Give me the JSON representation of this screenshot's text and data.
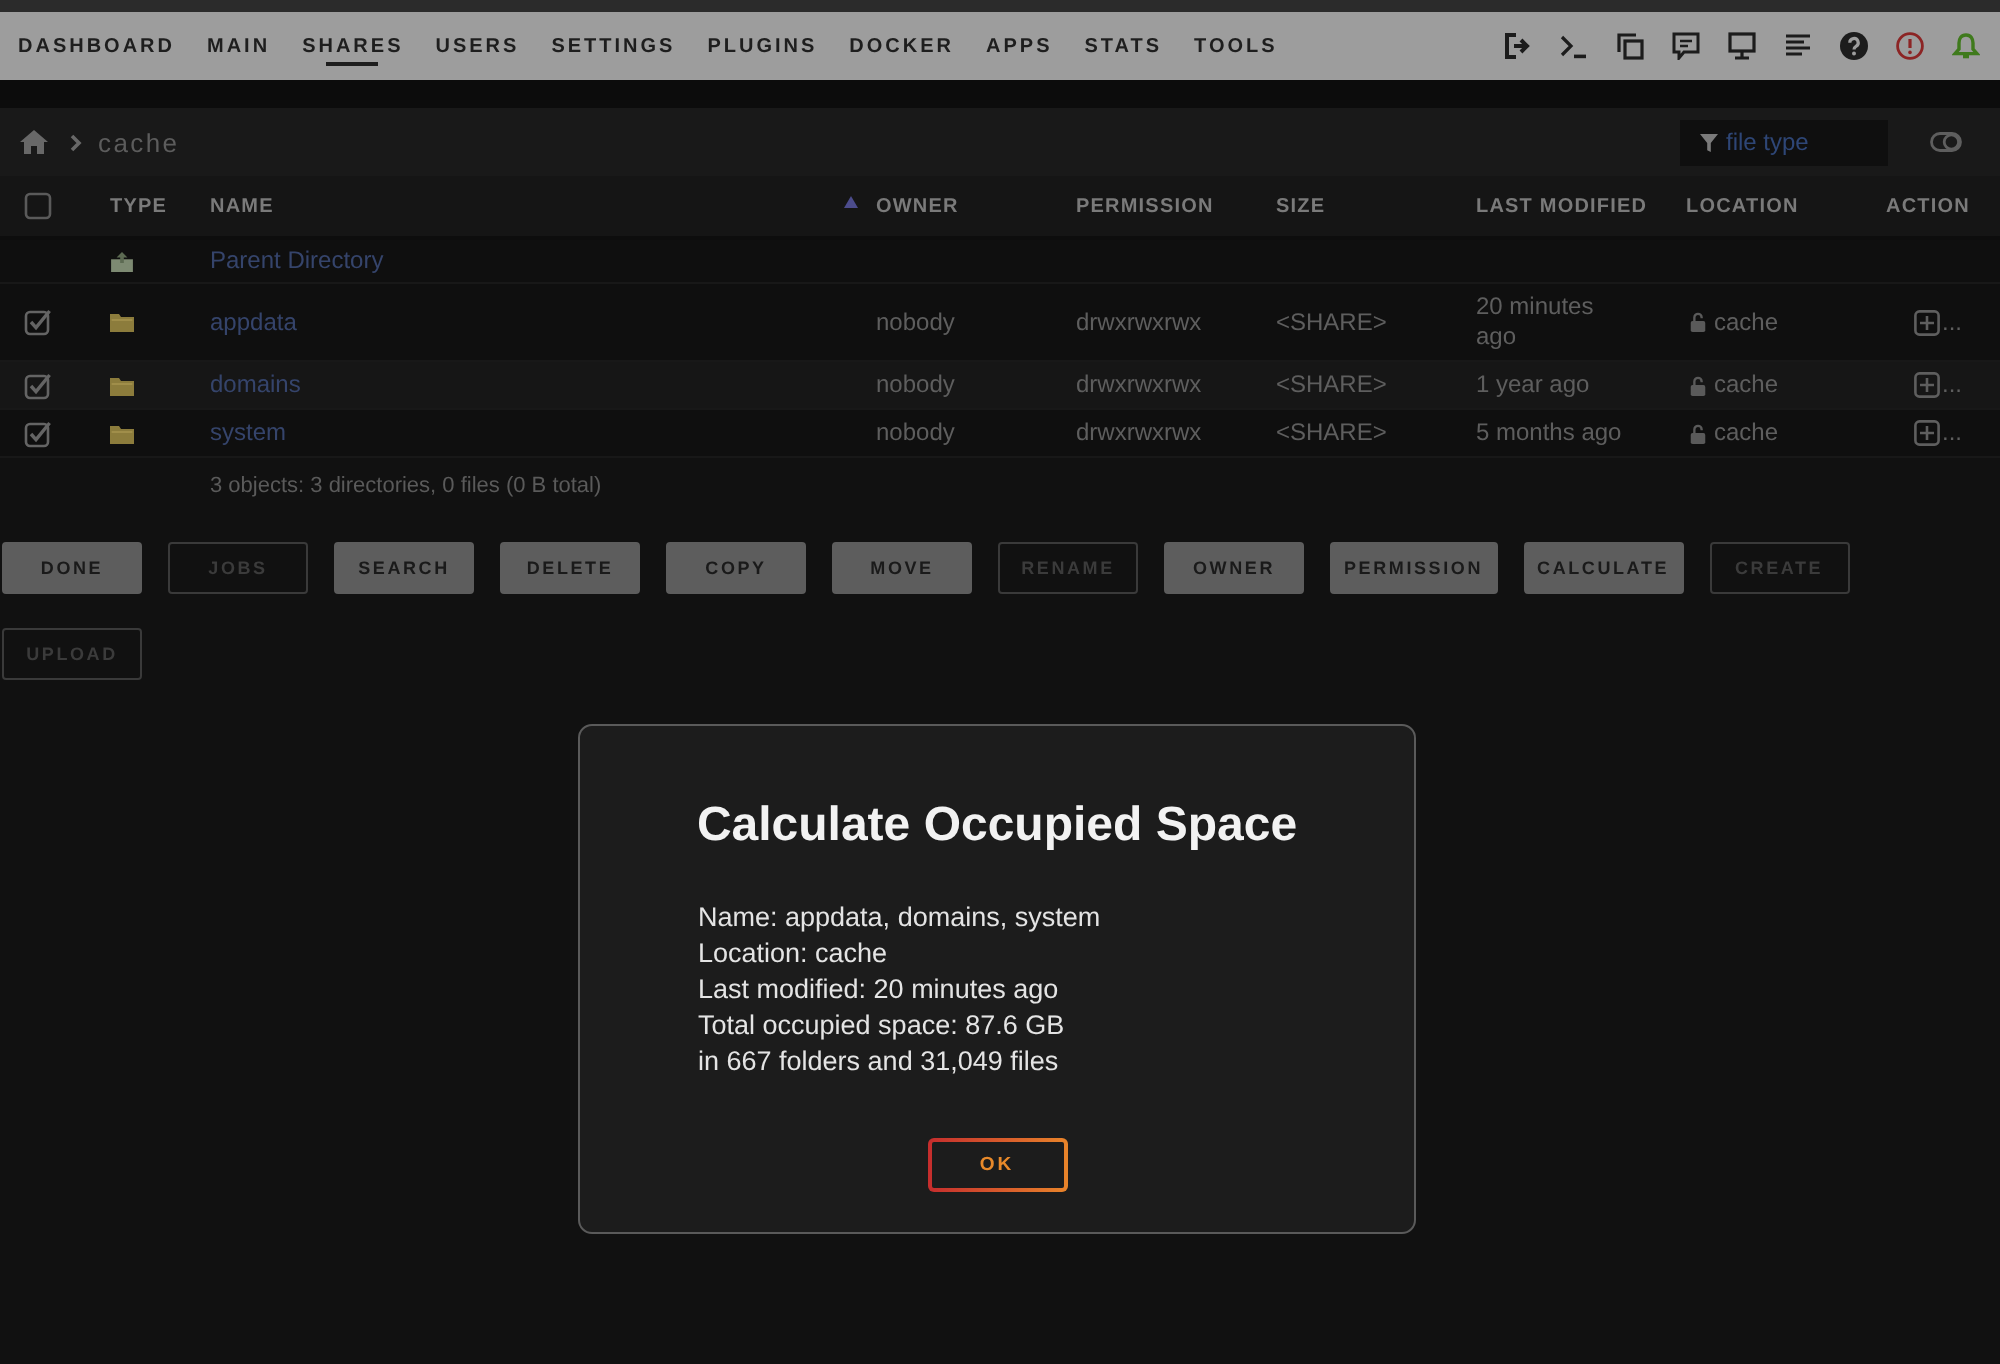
{
  "nav": {
    "tabs": [
      {
        "label": "DASHBOARD",
        "selected": false
      },
      {
        "label": "MAIN",
        "selected": false
      },
      {
        "label": "SHARES",
        "selected": true
      },
      {
        "label": "USERS",
        "selected": false
      },
      {
        "label": "SETTINGS",
        "selected": false
      },
      {
        "label": "PLUGINS",
        "selected": false
      },
      {
        "label": "DOCKER",
        "selected": false
      },
      {
        "label": "APPS",
        "selected": false
      },
      {
        "label": "STATS",
        "selected": false
      },
      {
        "label": "TOOLS",
        "selected": false
      }
    ]
  },
  "breadcrumb": {
    "path": [
      "cache"
    ]
  },
  "filter": {
    "placeholder": "file type"
  },
  "table": {
    "header_checkbox": {
      "checked": false
    },
    "columns": [
      {
        "label": "TYPE",
        "sorted": false
      },
      {
        "label": "NAME",
        "sorted": true
      },
      {
        "label": "OWNER",
        "sorted": false
      },
      {
        "label": "PERMISSION",
        "sorted": false
      },
      {
        "label": "SIZE",
        "sorted": false
      },
      {
        "label": "LAST MODIFIED",
        "sorted": false
      },
      {
        "label": "LOCATION",
        "sorted": false
      },
      {
        "label": "ACTION",
        "sorted": false
      }
    ],
    "rows": [
      {
        "kind": "parent",
        "name": "Parent Directory"
      },
      {
        "kind": "folder",
        "checked": true,
        "name": "appdata",
        "owner": "nobody",
        "permission": "drwxrwxrwx",
        "size": "<SHARE>",
        "last_modified": "20 minutes ago",
        "location": "cache",
        "action": "..."
      },
      {
        "kind": "folder",
        "checked": true,
        "name": "domains",
        "owner": "nobody",
        "permission": "drwxrwxrwx",
        "size": "<SHARE>",
        "last_modified": "1 year ago",
        "location": "cache",
        "action": "..."
      },
      {
        "kind": "folder",
        "checked": true,
        "name": "system",
        "owner": "nobody",
        "permission": "drwxrwxrwx",
        "size": "<SHARE>",
        "last_modified": "5 months ago",
        "location": "cache",
        "action": "..."
      }
    ],
    "summary": "3 objects: 3 directories, 0 files (0 B total)"
  },
  "buttons": [
    {
      "label": "DONE",
      "disabled": false
    },
    {
      "label": "JOBS",
      "disabled": true
    },
    {
      "label": "SEARCH",
      "disabled": false
    },
    {
      "label": "DELETE",
      "disabled": false
    },
    {
      "label": "COPY",
      "disabled": false
    },
    {
      "label": "MOVE",
      "disabled": false
    },
    {
      "label": "RENAME",
      "disabled": true
    },
    {
      "label": "OWNER",
      "disabled": false
    },
    {
      "label": "PERMISSION",
      "disabled": false
    },
    {
      "label": "CALCULATE",
      "disabled": false
    },
    {
      "label": "CREATE",
      "disabled": true
    },
    {
      "label": "UPLOAD",
      "disabled": true
    }
  ],
  "dialog": {
    "title": "Calculate Occupied Space",
    "lines": [
      "Name: appdata, domains, system",
      "Location: cache",
      "Last modified: 20 minutes ago",
      "Total occupied space: 87.6 GB",
      "in 667 folders and 31,049 files"
    ],
    "button": "OK"
  }
}
